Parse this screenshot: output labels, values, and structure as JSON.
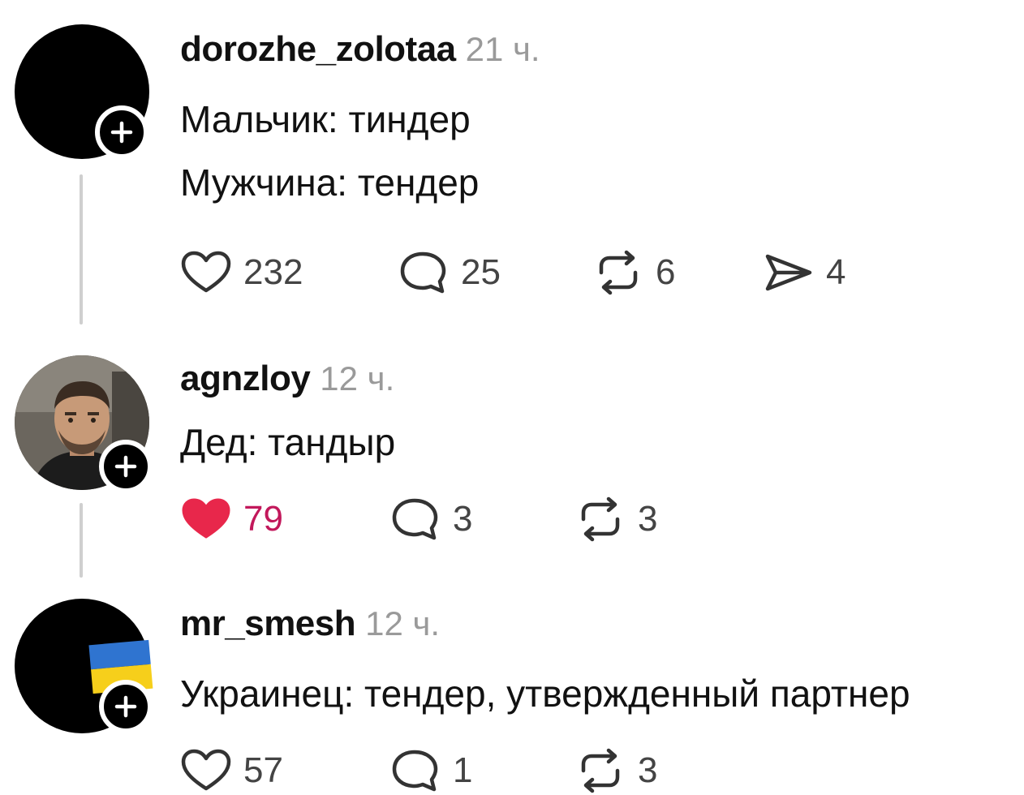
{
  "posts": [
    {
      "username": "dorozhe_zolotaa",
      "time": "21 ч.",
      "lines": [
        "Мальчик: тиндер",
        "Мужчина: тендер"
      ],
      "avatar": "black-avatar",
      "actions": {
        "likes": "232",
        "replies": "25",
        "reposts": "6",
        "shares": "4"
      },
      "liked": false
    },
    {
      "username": "agnzloy",
      "time": "12 ч.",
      "lines": [
        "Дед: тандыр"
      ],
      "avatar": "photo-avatar",
      "actions": {
        "likes": "79",
        "replies": "3",
        "reposts": "3"
      },
      "liked": true
    },
    {
      "username": "mr_smesh",
      "time": "12 ч.",
      "lines": [
        "Украинец: тендер, утвержденный партнер"
      ],
      "avatar": "black-avatar-with-flag",
      "actions": {
        "likes": "57",
        "replies": "1",
        "reposts": "3"
      },
      "liked": false
    }
  ],
  "colors": {
    "like_active": "#e8274b",
    "text": "#111111",
    "muted": "#9a9a9a",
    "icon": "#333333",
    "thread_line": "#cfcfcf"
  },
  "icons": {
    "follow": "plus-icon",
    "like": "heart-icon",
    "reply": "speech-bubble-icon",
    "repost": "repost-icon",
    "share": "paper-plane-icon"
  }
}
